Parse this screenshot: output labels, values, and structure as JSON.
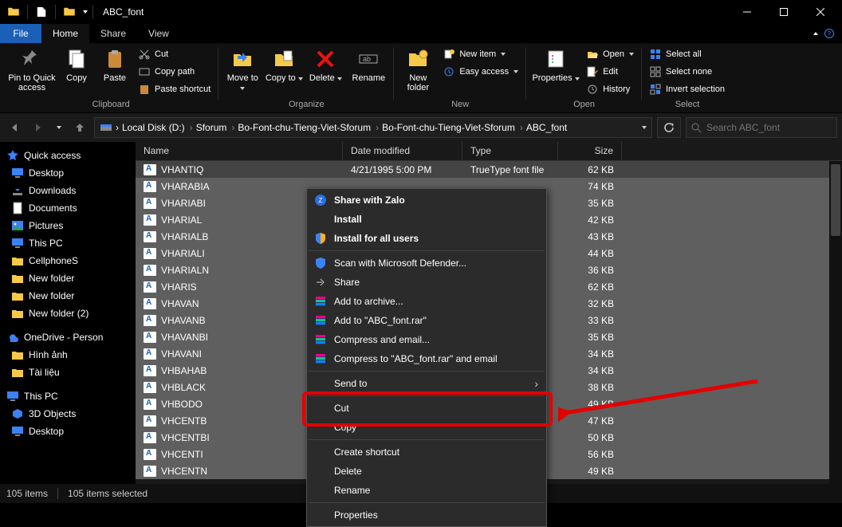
{
  "window": {
    "title": "ABC_font"
  },
  "menubar": {
    "file": "File",
    "tabs": [
      "Home",
      "Share",
      "View"
    ],
    "active": 0
  },
  "ribbon": {
    "clipboard": {
      "label": "Clipboard",
      "pin": "Pin to Quick access",
      "copy": "Copy",
      "paste": "Paste",
      "cut": "Cut",
      "copypath": "Copy path",
      "pastesc": "Paste shortcut"
    },
    "organize": {
      "label": "Organize",
      "moveto": "Move to",
      "copyto": "Copy to",
      "delete": "Delete",
      "rename": "Rename"
    },
    "new": {
      "label": "New",
      "newfolder": "New folder",
      "newitem": "New item",
      "easy": "Easy access"
    },
    "open": {
      "label": "Open",
      "properties": "Properties",
      "open": "Open",
      "edit": "Edit",
      "history": "History"
    },
    "select": {
      "label": "Select",
      "all": "Select all",
      "none": "Select none",
      "invert": "Invert selection"
    }
  },
  "nav": {
    "crumbs": [
      "Local Disk (D:)",
      "Sforum",
      "Bo-Font-chu-Tieng-Viet-Sforum",
      "Bo-Font-chu-Tieng-Viet-Sforum",
      "ABC_font"
    ],
    "search_placeholder": "Search ABC_font"
  },
  "sidebar": {
    "quick": "Quick access",
    "items1": [
      "Desktop",
      "Downloads",
      "Documents",
      "Pictures",
      "This PC",
      "CellphoneS",
      "New folder",
      "New folder",
      "New folder (2)"
    ],
    "onedrive": "OneDrive - Person",
    "items2": [
      "Hình ảnh",
      "Tài liệu"
    ],
    "thispc": "This PC",
    "items3": [
      "3D Objects",
      "Desktop"
    ]
  },
  "columns": {
    "name": "Name",
    "date": "Date modified",
    "type": "Type",
    "size": "Size"
  },
  "files": [
    {
      "name": "VHANTIQ",
      "date": "4/21/1995 5:00 PM",
      "type": "TrueType font file",
      "size": "62 KB"
    },
    {
      "name": "VHARABIA",
      "size": "74 KB"
    },
    {
      "name": "VHARIABI",
      "size": "35 KB"
    },
    {
      "name": "VHARIAL",
      "size": "42 KB"
    },
    {
      "name": "VHARIALB",
      "size": "43 KB"
    },
    {
      "name": "VHARIALI",
      "size": "44 KB"
    },
    {
      "name": "VHARIALN",
      "size": "36 KB"
    },
    {
      "name": "VHARIS",
      "size": "62 KB"
    },
    {
      "name": "VHAVAN",
      "size": "32 KB"
    },
    {
      "name": "VHAVANB",
      "size": "33 KB"
    },
    {
      "name": "VHAVANBI",
      "size": "35 KB"
    },
    {
      "name": "VHAVANI",
      "size": "34 KB"
    },
    {
      "name": "VHBAHAB",
      "size": "34 KB"
    },
    {
      "name": "VHBLACK",
      "size": "38 KB"
    },
    {
      "name": "VHBODO",
      "size": "49 KB"
    },
    {
      "name": "VHCENTB",
      "size": "47 KB"
    },
    {
      "name": "VHCENTBI",
      "size": "50 KB"
    },
    {
      "name": "VHCENTI",
      "size": "56 KB"
    },
    {
      "name": "VHCENTN",
      "size": "49 KB"
    }
  ],
  "context": {
    "sharezalo": "Share with Zalo",
    "install": "Install",
    "installall": "Install for all users",
    "defender": "Scan with Microsoft Defender...",
    "share": "Share",
    "addarchive": "Add to archive...",
    "addrar": "Add to \"ABC_font.rar\"",
    "compress": "Compress and email...",
    "compressrar": "Compress to \"ABC_font.rar\" and email",
    "sendto": "Send to",
    "cut": "Cut",
    "copy": "Copy",
    "shortcut": "Create shortcut",
    "delete": "Delete",
    "rename": "Rename",
    "properties": "Properties"
  },
  "status": {
    "items": "105 items",
    "selected": "105 items selected"
  }
}
